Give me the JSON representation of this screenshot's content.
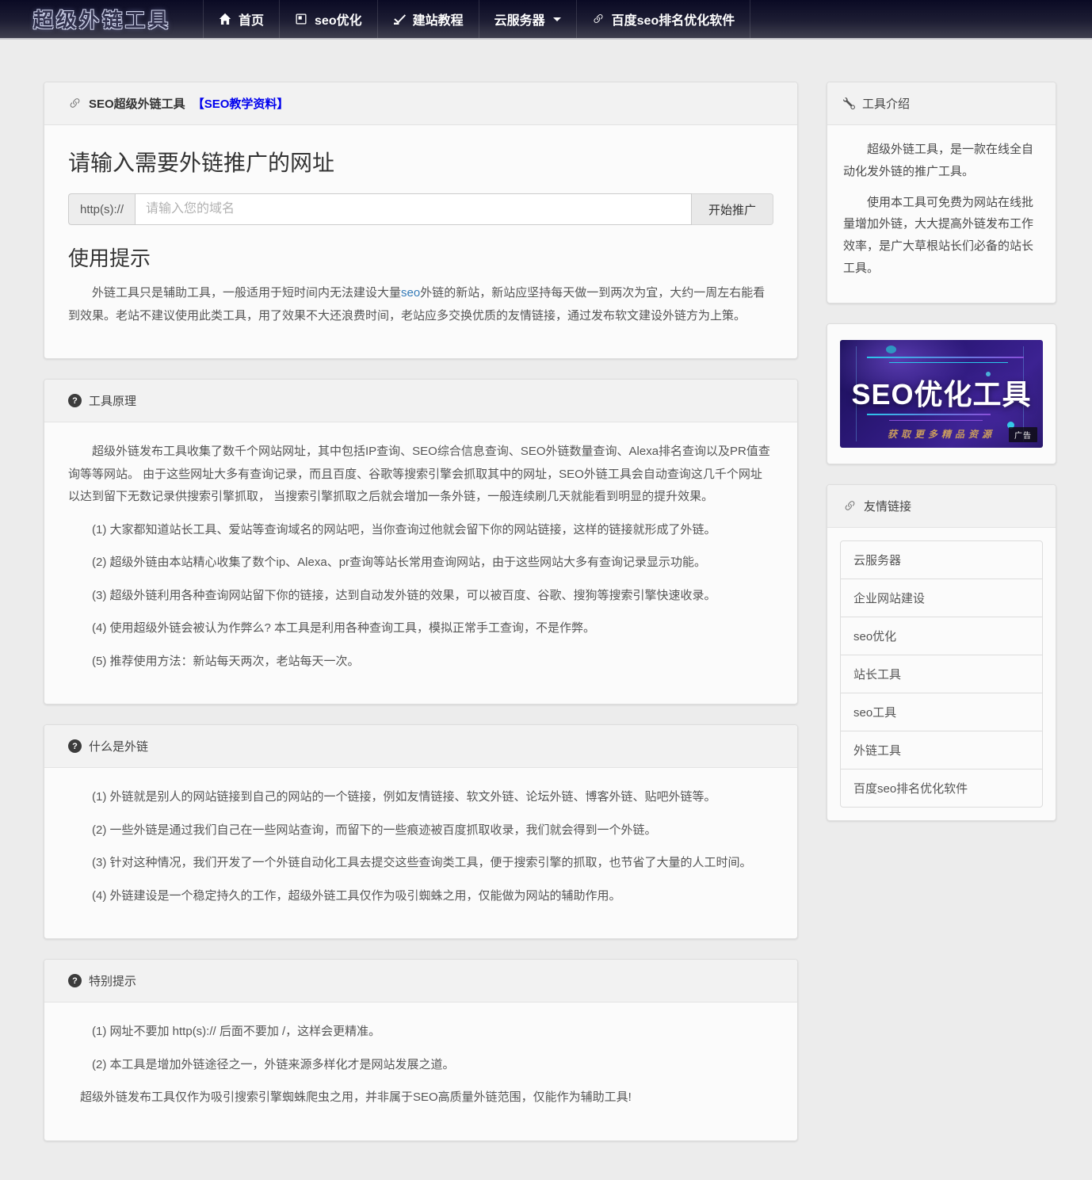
{
  "colors": {
    "navbar-top": "#0a0a24",
    "navbar-bottom": "#3f3f4e",
    "page-bg": "#ececec",
    "card-bg": "#fbfbfb",
    "card-header-bg": "#f2f2f2",
    "card-border": "#dedede",
    "heading-text": "#333333",
    "body-text": "#555555",
    "title-link": "#0000ee",
    "inline-link": "#337ab7",
    "banner-gold": "#c89b5e",
    "banner-line-cyan": "#2bc6ea"
  },
  "navbar": {
    "brand": "超级外链工具",
    "items": [
      {
        "label": "首页",
        "icon": "home-icon"
      },
      {
        "label": "seo优化",
        "icon": "journal-icon"
      },
      {
        "label": "建站教程",
        "icon": "check-underline-icon"
      },
      {
        "label": "云服务器",
        "icon": "caret-down-icon"
      },
      {
        "label": "百度seo排名优化软件",
        "icon": "link-icon"
      }
    ]
  },
  "main": {
    "tool_card": {
      "header_title": "SEO超级外链工具",
      "header_link": "【SEO教学资料】",
      "input_heading": "请输入需要外链推广的网址",
      "protocol_prefix": "http(s)://",
      "input_placeholder": "请输入您的域名",
      "input_value": "",
      "submit_label": "开始推广",
      "tips_heading": "使用提示",
      "tips_before": "外链工具只是辅助工具，一般适用于短时间内无法建设大量",
      "tips_link_text": "seo",
      "tips_after": "外链的新站，新站应坚持每天做一到两次为宜，大约一周左右能看到效果。老站不建议使用此类工具，用了效果不大还浪费时间，老站应多交换优质的友情链接，通过发布软文建设外链方为上策。"
    },
    "principle_card": {
      "title": "工具原理",
      "intro": "超级外链发布工具收集了数千个网站网址，其中包括IP查询、SEO综合信息查询、SEO外链数量查询、Alexa排名查询以及PR值查询等等网站。 由于这些网址大多有查询记录，而且百度、谷歌等搜索引擎会抓取其中的网址，SEO外链工具会自动查询这几千个网址以达到留下无数记录供搜索引擎抓取， 当搜索引擎抓取之后就会增加一条外链，一般连续刷几天就能看到明显的提升效果。",
      "items": [
        "(1) 大家都知道站长工具、爱站等查询域名的网站吧，当你查询过他就会留下你的网站链接，这样的链接就形成了外链。",
        "(2) 超级外链由本站精心收集了数个ip、Alexa、pr查询等站长常用查询网站，由于这些网站大多有查询记录显示功能。",
        "(3) 超级外链利用各种查询网站留下你的链接，达到自动发外链的效果，可以被百度、谷歌、搜狗等搜索引擎快速收录。",
        "(4) 使用超级外链会被认为作弊么? 本工具是利用各种查询工具，模拟正常手工查询，不是作弊。",
        "(5) 推荐使用方法：新站每天两次，老站每天一次。"
      ]
    },
    "whatis_card": {
      "title": "什么是外链",
      "items": [
        "(1) 外链就是别人的网站链接到自己的网站的一个链接，例如友情链接、软文外链、论坛外链、博客外链、贴吧外链等。",
        "(2) 一些外链是通过我们自己在一些网站查询，而留下的一些痕迹被百度抓取收录，我们就会得到一个外链。",
        "(3) 针对这种情况，我们开发了一个外链自动化工具去提交这些查询类工具，便于搜索引擎的抓取，也节省了大量的人工时间。",
        "(4) 外链建设是一个稳定持久的工作，超级外链工具仅作为吸引蜘蛛之用，仅能做为网站的辅助作用。"
      ]
    },
    "special_card": {
      "title": "特别提示",
      "items": [
        "(1) 网址不要加 http(s):// 后面不要加 /，这样会更精准。",
        "(2) 本工具是增加外链途径之一，外链来源多样化才是网站发展之道。"
      ],
      "footnote": "超级外链发布工具仅作为吸引搜索引擎蜘蛛爬虫之用，并非属于SEO高质量外链范围，仅能作为辅助工具!"
    }
  },
  "sidebar": {
    "intro_card": {
      "title": "工具介绍",
      "paragraphs": [
        "超级外链工具，是一款在线全自动化发外链的推广工具。",
        "使用本工具可免费为网站在线批量增加外链，大大提高外链发布工作效率，是广大草根站长们必备的站长工具。"
      ]
    },
    "banner": {
      "title": "SEO优化工具",
      "subtitle": "获取更多精品资源",
      "ad_label": "广告"
    },
    "links_card": {
      "title": "友情链接",
      "links": [
        "云服务器",
        "企业网站建设",
        "seo优化",
        "站长工具",
        "seo工具",
        "外链工具",
        "百度seo排名优化软件"
      ]
    }
  }
}
